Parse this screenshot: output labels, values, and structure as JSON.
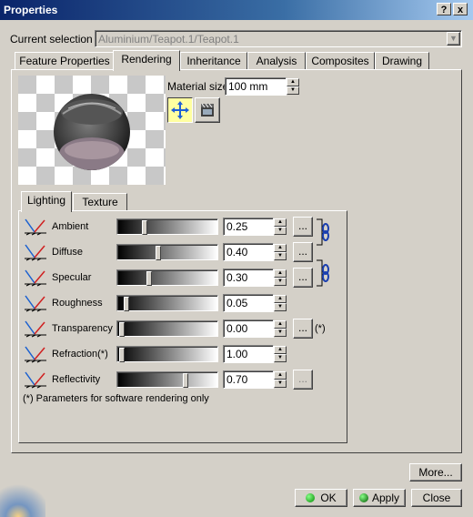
{
  "window": {
    "title": "Properties",
    "help_label": "?",
    "close_label": "x"
  },
  "selection": {
    "label": "Current selection :",
    "value": "Aluminium/Teapot.1/Teapot.1"
  },
  "tabs": [
    {
      "label": "Feature Properties"
    },
    {
      "label": "Rendering"
    },
    {
      "label": "Inheritance"
    },
    {
      "label": "Analysis"
    },
    {
      "label": "Composites"
    },
    {
      "label": "Drawing"
    }
  ],
  "rendering": {
    "material_size_label": "Material size:",
    "material_size_value": "100 mm"
  },
  "subtabs": [
    {
      "label": "Lighting"
    },
    {
      "label": "Texture"
    }
  ],
  "lighting": [
    {
      "label": "Ambient",
      "value": "0.25",
      "level": 0.25,
      "has_button": true,
      "button_label": "..."
    },
    {
      "label": "Diffuse",
      "value": "0.40",
      "level": 0.4,
      "has_button": true,
      "button_label": "..."
    },
    {
      "label": "Specular",
      "value": "0.30",
      "level": 0.3,
      "has_button": true,
      "button_label": "..."
    },
    {
      "label": "Roughness",
      "value": "0.05",
      "level": 0.05,
      "has_button": false
    },
    {
      "label": "Transparency",
      "value": "0.00",
      "level": 0.0,
      "has_button": true,
      "button_label": "...",
      "suffix": "(*)"
    },
    {
      "label": "Refraction(*)",
      "value": "1.00",
      "level": 0.0,
      "has_button": false
    },
    {
      "label": "Reflectivity",
      "value": "0.70",
      "level": 0.7,
      "has_button": true,
      "button_label": "...",
      "disabled": true
    }
  ],
  "footnote": "(*) Parameters for software rendering only",
  "buttons": {
    "more": "More...",
    "ok": "OK",
    "apply": "Apply",
    "close": "Close"
  }
}
